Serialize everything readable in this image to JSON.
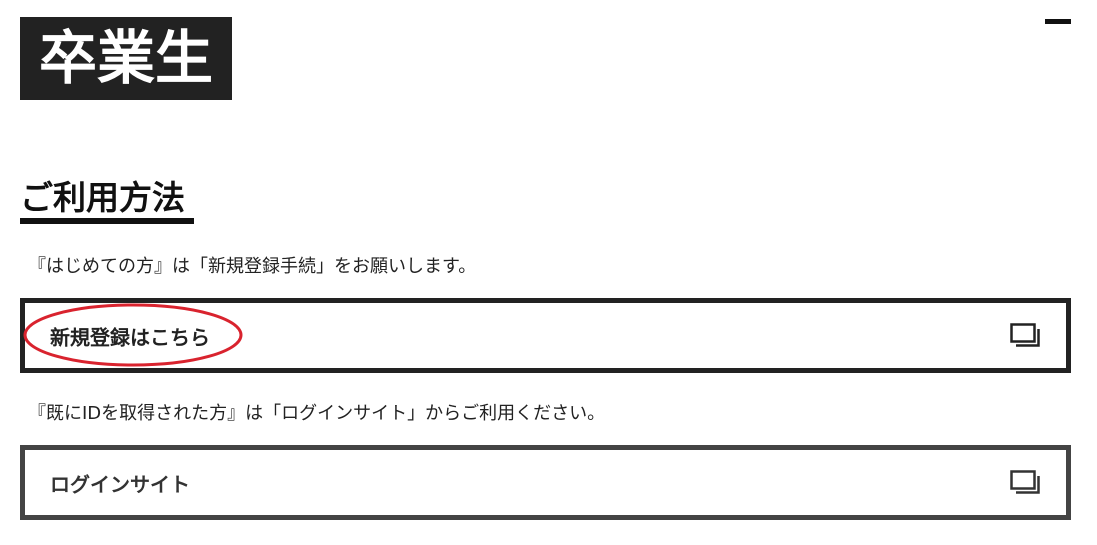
{
  "header": {
    "logo_text": "卒業生",
    "menu_icon": "menu-icon"
  },
  "section": {
    "title": "ご利用方法"
  },
  "registration": {
    "description": "『はじめての方』は「新規登録手続」をお願いします。",
    "link_label": "新規登録はこちら",
    "link_icon": "external-window-icon"
  },
  "login": {
    "description": "『既にIDを取得された方』は「ログインサイト」からご利用ください。",
    "link_label": "ログインサイト",
    "link_icon": "external-window-icon"
  },
  "annotation": {
    "highlight_color": "#d9232e"
  },
  "colors": {
    "logo_bg": "#222222",
    "logo_text": "#ffffff",
    "border_dark": "#222222",
    "border_gray": "#444444",
    "text": "#111111"
  }
}
